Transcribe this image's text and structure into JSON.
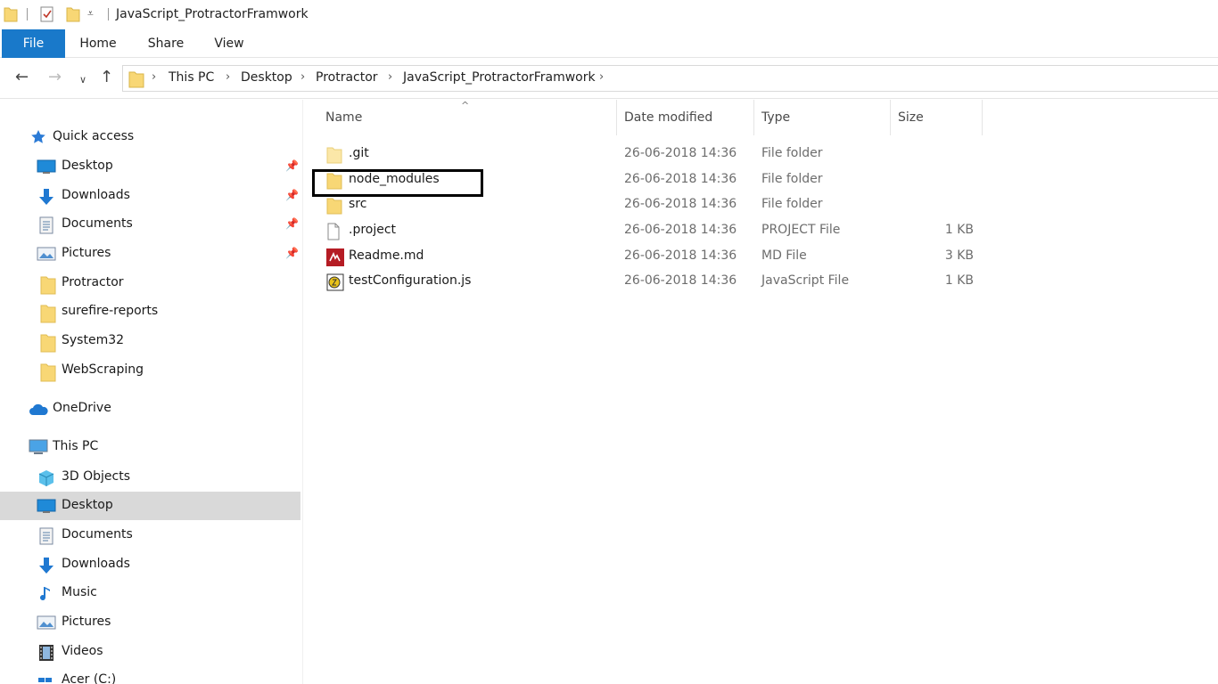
{
  "window": {
    "title": "JavaScript_ProtractorFramwork"
  },
  "ribbon": {
    "tabs": [
      "File",
      "Home",
      "Share",
      "View"
    ]
  },
  "address": {
    "crumbs": [
      "This PC",
      "Desktop",
      "Protractor",
      "JavaScript_ProtractorFramwork"
    ]
  },
  "sidebar": {
    "quick_access": "Quick access",
    "quick_items": [
      {
        "label": "Desktop",
        "icon": "desktop-icon"
      },
      {
        "label": "Downloads",
        "icon": "download-icon"
      },
      {
        "label": "Documents",
        "icon": "document-icon"
      },
      {
        "label": "Pictures",
        "icon": "pictures-icon"
      },
      {
        "label": "Protractor",
        "icon": "folder-icon"
      },
      {
        "label": "surefire-reports",
        "icon": "folder-icon"
      },
      {
        "label": "System32",
        "icon": "folder-icon"
      },
      {
        "label": "WebScraping",
        "icon": "folder-icon"
      }
    ],
    "onedrive": "OneDrive",
    "this_pc": "This PC",
    "pc_items": [
      {
        "label": "3D Objects",
        "icon": "cube-icon"
      },
      {
        "label": "Desktop",
        "icon": "desktop-icon"
      },
      {
        "label": "Documents",
        "icon": "document-icon"
      },
      {
        "label": "Downloads",
        "icon": "download-icon"
      },
      {
        "label": "Music",
        "icon": "music-icon"
      },
      {
        "label": "Pictures",
        "icon": "pictures-icon"
      },
      {
        "label": "Videos",
        "icon": "video-icon"
      },
      {
        "label": "Acer (C:)",
        "icon": "drive-icon"
      }
    ]
  },
  "columns": {
    "name": "Name",
    "date": "Date modified",
    "type": "Type",
    "size": "Size"
  },
  "files": [
    {
      "name": ".git",
      "date": "26-06-2018 14:36",
      "type": "File folder",
      "size": "",
      "icon": "folder-icon"
    },
    {
      "name": "node_modules",
      "date": "26-06-2018 14:36",
      "type": "File folder",
      "size": "",
      "icon": "folder-icon"
    },
    {
      "name": "src",
      "date": "26-06-2018 14:36",
      "type": "File folder",
      "size": "",
      "icon": "folder-icon"
    },
    {
      "name": ".project",
      "date": "26-06-2018 14:36",
      "type": "PROJECT File",
      "size": "1 KB",
      "icon": "file-icon"
    },
    {
      "name": "Readme.md",
      "date": "26-06-2018 14:36",
      "type": "MD File",
      "size": "3 KB",
      "icon": "markdown-icon"
    },
    {
      "name": "testConfiguration.js",
      "date": "26-06-2018 14:36",
      "type": "JavaScript File",
      "size": "1 KB",
      "icon": "javascript-icon"
    }
  ],
  "colors": {
    "accent": "#1979ca",
    "folder": "#f8d775",
    "selected": "#d9d9d9",
    "highlight_box": "#000000"
  }
}
